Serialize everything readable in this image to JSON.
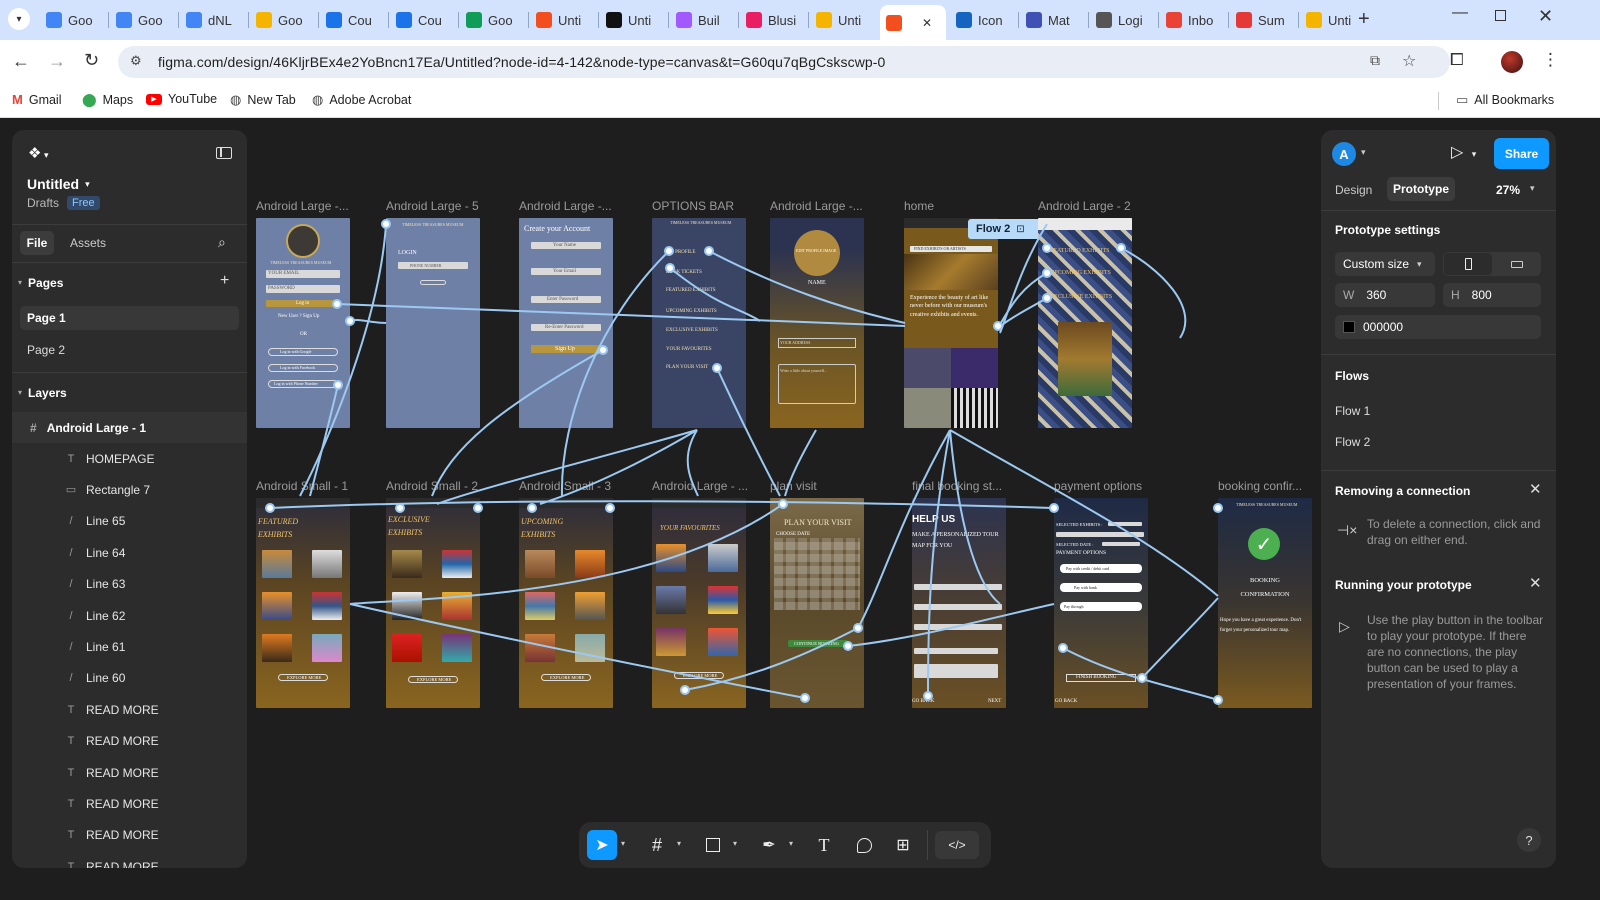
{
  "browser": {
    "tabs": [
      {
        "title": "Goo",
        "color": "#4285f4"
      },
      {
        "title": "Goo",
        "color": "#4285f4"
      },
      {
        "title": "dNL",
        "color": "#4285f4"
      },
      {
        "title": "Goo",
        "color": "#f4b400"
      },
      {
        "title": "Cou",
        "color": "#1a73e8"
      },
      {
        "title": "Cou",
        "color": "#1a73e8"
      },
      {
        "title": "Goo",
        "color": "#0f9d58"
      },
      {
        "title": "Unti",
        "color": "#f24e1e"
      },
      {
        "title": "Unti",
        "color": "#111111"
      },
      {
        "title": "Buil",
        "color": "#a259ff"
      },
      {
        "title": "Blusi",
        "color": "#e91e63"
      },
      {
        "title": "Unti",
        "color": "#f4b400"
      },
      {
        "title": "",
        "color": "#f24e1e"
      },
      {
        "title": "Icon",
        "color": "#1565c0"
      },
      {
        "title": "Mat",
        "color": "#3f51b5"
      },
      {
        "title": "Logi",
        "color": "#555555"
      },
      {
        "title": "Inbo",
        "color": "#ea4335"
      },
      {
        "title": "Sum",
        "color": "#e53935"
      },
      {
        "title": "Unti",
        "color": "#f4b400"
      }
    ],
    "url": "figma.com/design/46KljrBEx4e2YoBncn17Ea/Untitled?node-id=4-142&node-type=canvas&t=G60qu7qBgCskscwp-0",
    "bookmarks": [
      "Gmail",
      "Maps",
      "YouTube",
      "New Tab",
      "Adobe Acrobat"
    ],
    "all_bookmarks": "All Bookmarks"
  },
  "file": {
    "name": "Untitled",
    "location": "Drafts",
    "plan_badge": "Free"
  },
  "left_panel": {
    "tab_file": "File",
    "tab_assets": "Assets",
    "pages_header": "Pages",
    "pages": [
      "Page 1",
      "Page 2"
    ],
    "layers_header": "Layers",
    "root_layer": "Android Large - 1",
    "layers": [
      {
        "name": "HOMEPAGE",
        "icon": "T"
      },
      {
        "name": "Rectangle 7",
        "icon": "▭"
      },
      {
        "name": "Line 65",
        "icon": "/"
      },
      {
        "name": "Line 64",
        "icon": "/"
      },
      {
        "name": "Line 63",
        "icon": "/"
      },
      {
        "name": "Line 62",
        "icon": "/"
      },
      {
        "name": "Line 61",
        "icon": "/"
      },
      {
        "name": "Line 60",
        "icon": "/"
      },
      {
        "name": "READ MORE",
        "icon": "T"
      },
      {
        "name": "READ MORE",
        "icon": "T"
      },
      {
        "name": "READ MORE",
        "icon": "T"
      },
      {
        "name": "READ MORE",
        "icon": "T"
      },
      {
        "name": "READ MORE",
        "icon": "T"
      },
      {
        "name": "READ MORE",
        "icon": "T"
      }
    ]
  },
  "canvas": {
    "frame_labels_top": [
      "Android Large -...",
      "Android Large - 5",
      "Android Large -...",
      "OPTIONS BAR",
      "Android Large -...",
      "home",
      "Android Large - 2"
    ],
    "frame_labels_bottom": [
      "Android Small - 1",
      "Android Small - 2",
      "Android Small - 3",
      "Android Large - ...",
      "plan visit",
      "final booking st...",
      "payment options",
      "booking confir..."
    ],
    "flow_badge": "Flow 2",
    "museum_name": "TIMELESS TREASURES MUSEUM",
    "login_title": "LOGIN",
    "phone_placeholder": "PHONE NUMBER",
    "create_account": "Create your Account",
    "signup_fields": [
      "Your Name",
      "Your Email",
      "Enter Password",
      "Re-Enter Password"
    ],
    "sign_up": "Sign Up",
    "login_fields": [
      "YOUR EMAIL",
      "PASSWORD"
    ],
    "log_in": "Log in",
    "new_user": "New User ? Sign Up",
    "or": "OR",
    "social_logins": [
      "Log in with Google",
      "Log in with Facebook",
      "Log in with Phone Number"
    ],
    "options_items": [
      "MY PROFILE",
      "BOOK TICKETS",
      "FEATURED EXHIBITS",
      "UPCOMING EXHIBITS",
      "EXCLUSIVE EXHIBITS",
      "YOUR FAVOURITES",
      "PLAN YOUR VISIT"
    ],
    "profile": {
      "edit": "EDIT PROFILE IMAGE",
      "name": "NAME",
      "address": "YOUR ADDRESS",
      "bio": "Write a little about yourself..."
    },
    "home": {
      "search": "FIND EXHIBITS OR ARTISTS",
      "tagline": "Experience the beauty of art like never before with our museum's creative exhibits and events."
    },
    "exhibit_tabs": [
      "FEATURED EXHIBITS",
      "UPCOMING EXHIBITS",
      "EXCLUSIVE EXHIBITS"
    ],
    "featured_exhibits": "FEATURED EXHIBITS",
    "exclusive_exhibits": "EXCLUSIVE EXHIBITS",
    "upcoming_exhibits": "UPCOMING EXHIBITS",
    "your_favourites": "YOUR FAVOURITES",
    "explore_more": "EXPLORE MORE",
    "plan_your_visit": "PLAN YOUR VISIT",
    "choose_date": "CHOOSE DATE",
    "continue_booking": "CONTINUE BOOKING",
    "helpus": "HELP US",
    "helpus_sub": "MAKE A PERSONALIZED TOUR MAP FOR YOU",
    "go_back": "GO BACK",
    "next": "NEXT",
    "selected_exhibits": "SELECTED EXHIBITS :",
    "selected_date": "SELECTED DATE :",
    "payment_options": "PAYMENT OPTIONS",
    "pay_card": "Pay with credit / debit card",
    "pay_bank": "Pay with bank",
    "pay_through": "Pay through",
    "finish_booking": "FINISH BOOKING",
    "booking_confirmation": "BOOKING CONFIRMATION",
    "booking_text": "Hope you have a great experience. Don't forget your personalized tour map."
  },
  "right_panel": {
    "avatar_letter": "A",
    "share": "Share",
    "tab_design": "Design",
    "tab_prototype": "Prototype",
    "zoom": "27%",
    "prototype_settings": "Prototype settings",
    "size_preset": "Custom size",
    "width_label": "W",
    "width_value": "360",
    "height_label": "H",
    "height_value": "800",
    "background_hex": "000000",
    "flows_header": "Flows",
    "flows": [
      "Flow 1",
      "Flow 2"
    ],
    "removing_title": "Removing a connection",
    "removing_text": "To delete a connection, click and drag on either end.",
    "running_title": "Running your prototype",
    "running_text": "Use the play button in the toolbar to play your prototype. If there are no connections, the play button can be used to play a presentation of your frames."
  },
  "colors": {
    "accent": "#0d99ff",
    "connection": "#9cc9f2",
    "frame_blue": "#6f7fa2",
    "frame_gold": "#8a6520",
    "frame_navy": "#3a4566"
  }
}
